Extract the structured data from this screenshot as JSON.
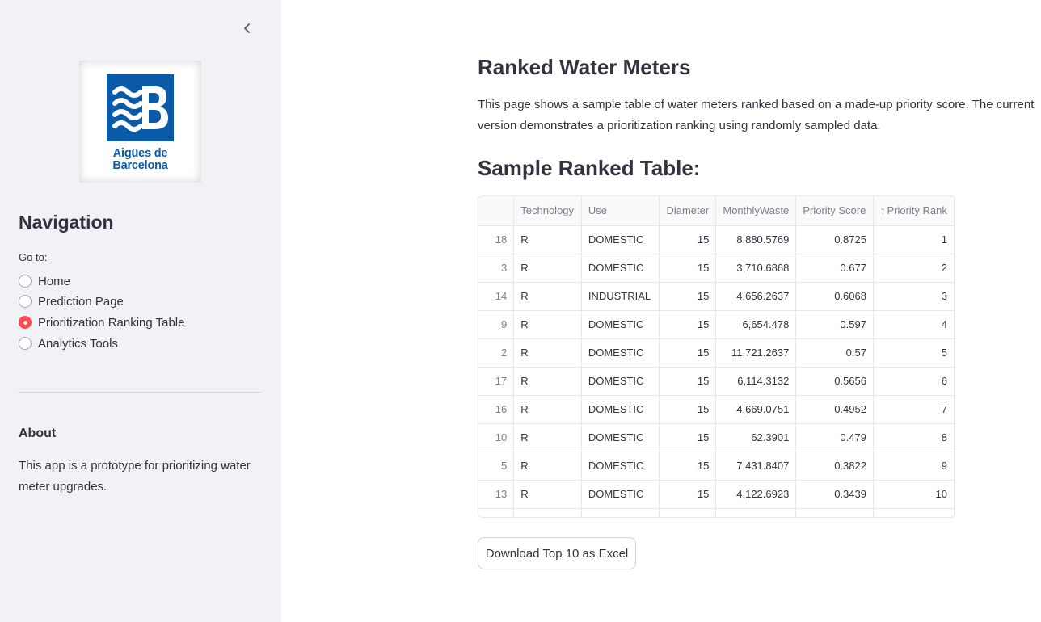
{
  "sidebar": {
    "collapse_icon": "chevron-left-icon",
    "logo": {
      "line1": "Aigües de",
      "line2": "Barcelona",
      "brand_color": "#0b5aa7"
    },
    "nav_title": "Navigation",
    "goto_label": "Go to:",
    "nav_options": [
      {
        "label": "Home",
        "selected": false
      },
      {
        "label": "Prediction Page",
        "selected": false
      },
      {
        "label": "Prioritization Ranking Table",
        "selected": true
      },
      {
        "label": "Analytics Tools",
        "selected": false
      }
    ],
    "about_title": "About",
    "about_text": "This app is a prototype for prioritizing water meter upgrades."
  },
  "main": {
    "title": "Ranked Water Meters",
    "description": "This page shows a sample table of water meters ranked based on a made-up priority score. The current version demonstrates a prioritization ranking using randomly sampled data.",
    "section_title": "Sample Ranked Table:",
    "table": {
      "columns": [
        "",
        "Technology",
        "Use",
        "Diameter",
        "MonthlyWaste",
        "Priority Score",
        "Priority Rank"
      ],
      "sorted_column": "Priority Rank",
      "sort_direction": "ascending",
      "rows": [
        [
          "18",
          "R",
          "DOMESTIC",
          "15",
          "8,880.5769",
          "0.8725",
          "1"
        ],
        [
          "3",
          "R",
          "DOMESTIC",
          "15",
          "3,710.6868",
          "0.677",
          "2"
        ],
        [
          "14",
          "R",
          "INDUSTRIAL",
          "15",
          "4,656.2637",
          "0.6068",
          "3"
        ],
        [
          "9",
          "R",
          "DOMESTIC",
          "15",
          "6,654.478",
          "0.597",
          "4"
        ],
        [
          "2",
          "R",
          "DOMESTIC",
          "15",
          "11,721.2637",
          "0.57",
          "5"
        ],
        [
          "17",
          "R",
          "DOMESTIC",
          "15",
          "6,114.3132",
          "0.5656",
          "6"
        ],
        [
          "16",
          "R",
          "DOMESTIC",
          "15",
          "4,669.0751",
          "0.4952",
          "7"
        ],
        [
          "10",
          "R",
          "DOMESTIC",
          "15",
          "62.3901",
          "0.479",
          "8"
        ],
        [
          "5",
          "R",
          "DOMESTIC",
          "15",
          "7,431.8407",
          "0.3822",
          "9"
        ],
        [
          "13",
          "R",
          "DOMESTIC",
          "15",
          "4,122.6923",
          "0.3439",
          "10"
        ],
        [
          "",
          "",
          "",
          "",
          "",
          "",
          ""
        ]
      ]
    },
    "download_label": "Download Top 10 as Excel"
  },
  "colors": {
    "accent": "#ff4b4b",
    "sidebar_bg": "#f0f2f6"
  }
}
